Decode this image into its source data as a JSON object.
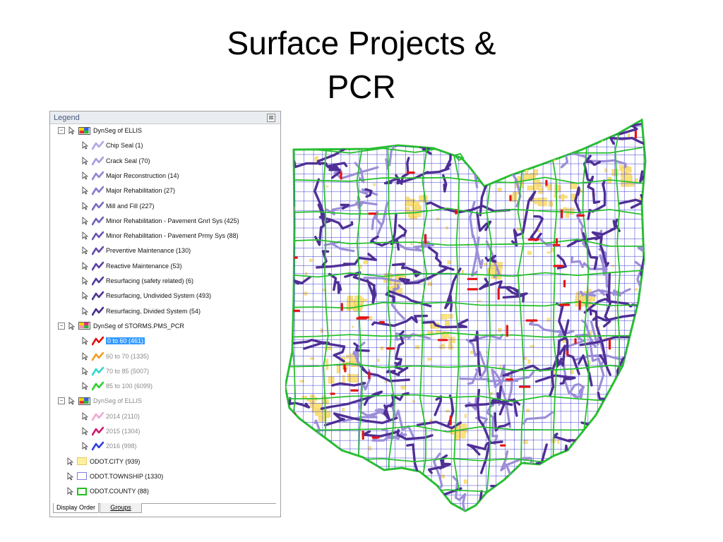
{
  "slide": {
    "title_line1": "Surface Projects &",
    "title_line2": "PCR"
  },
  "legend": {
    "title": "Legend",
    "close_glyph": "⊠",
    "groups": [
      {
        "name": "DynSeg of ELLIS",
        "items": [
          {
            "label": "Chip Seal (1)",
            "color": "#b3a6e6"
          },
          {
            "label": "Crack Seal (70)",
            "color": "#a99be0"
          },
          {
            "label": "Major Reconstruction (14)",
            "color": "#9485d3"
          },
          {
            "label": "Major Rehabilitation (27)",
            "color": "#8a78cc"
          },
          {
            "label": "Mill and Fill (227)",
            "color": "#7c69c2"
          },
          {
            "label": "Minor Rehabilitation - Pavement Gnrl Sys (425)",
            "color": "#7360bb"
          },
          {
            "label": "Minor Rehabilitation - Pavement Prmy Sys (88)",
            "color": "#6a55b3"
          },
          {
            "label": "Preventive Maintenance (130)",
            "color": "#634bab"
          },
          {
            "label": "Reactive Maintenance (53)",
            "color": "#5b42a3"
          },
          {
            "label": "Resurfacing (safety related) (6)",
            "color": "#553b9c"
          },
          {
            "label": "Resurfacing,  Undivided System (493)",
            "color": "#4e3494"
          },
          {
            "label": "Resurfacing, Divided System (54)",
            "color": "#472d8c"
          }
        ]
      },
      {
        "name": "DynSeg of STORMS.PMS_PCR",
        "items": [
          {
            "label": "0 to 60 (461)",
            "color": "#e01010",
            "selected": true
          },
          {
            "label": "60 to 70 (1335)",
            "color": "#f0a020"
          },
          {
            "label": "70 to 85 (5007)",
            "color": "#30d8d0"
          },
          {
            "label": "85 to 100 (6099)",
            "color": "#30d030"
          }
        ]
      },
      {
        "name": "DynSeg of ELLIS",
        "items": [
          {
            "label": "2014 (2110)",
            "color": "#f0a8d0"
          },
          {
            "label": "2015 (1304)",
            "color": "#d01870"
          },
          {
            "label": "2016 (998)",
            "color": "#3040d8"
          }
        ]
      }
    ],
    "layers": [
      {
        "label": "ODOT.CITY (939)",
        "fill": "#fdf0a0",
        "stroke": "#e8c860"
      },
      {
        "label": "ODOT.TOWNSHIP (1330)",
        "fill": "#ffffff",
        "stroke": "#8080e0"
      },
      {
        "label": "ODOT.COUNTY (88)",
        "fill": "#ffffff",
        "stroke": "#20c020"
      }
    ],
    "tabs": [
      "Display Order",
      "Groups"
    ]
  },
  "map_colors": {
    "county": "#28c030",
    "township": "#3a3ad0",
    "city": "#fce27a",
    "project_dark": "#4f2f96",
    "project_light": "#9c8ed8",
    "low_pcr": "#e41414"
  }
}
